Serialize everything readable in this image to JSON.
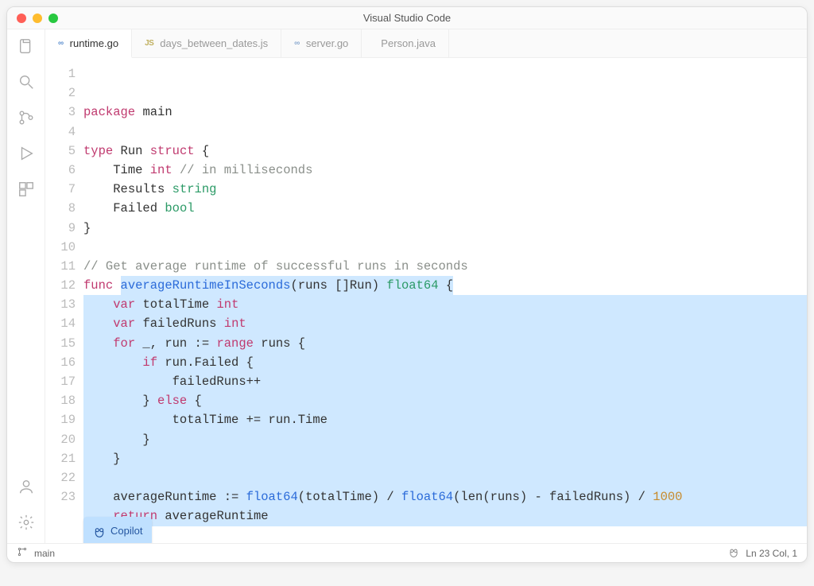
{
  "app_title": "Visual Studio Code",
  "tabs": [
    {
      "label": "runtime.go",
      "lang": "∞",
      "lang_class": "lang-go active-lang",
      "active": true
    },
    {
      "label": "days_between_dates.js",
      "lang": "JS",
      "lang_class": "lang-js",
      "active": false
    },
    {
      "label": "server.go",
      "lang": "∞",
      "lang_class": "lang-go",
      "active": false
    },
    {
      "label": "Person.java",
      "lang": "",
      "lang_class": "lang-java",
      "active": false
    }
  ],
  "code_lines": [
    {
      "n": 1,
      "hl": "none",
      "tokens": [
        [
          "kw",
          "package"
        ],
        [
          "plain",
          " "
        ],
        [
          "ident",
          "main"
        ]
      ]
    },
    {
      "n": 2,
      "hl": "none",
      "tokens": []
    },
    {
      "n": 3,
      "hl": "none",
      "tokens": [
        [
          "kw",
          "type"
        ],
        [
          "plain",
          " "
        ],
        [
          "ident",
          "Run"
        ],
        [
          "plain",
          " "
        ],
        [
          "kw",
          "struct"
        ],
        [
          "plain",
          " {"
        ]
      ]
    },
    {
      "n": 4,
      "hl": "none",
      "tokens": [
        [
          "plain",
          "    "
        ],
        [
          "ident",
          "Time"
        ],
        [
          "plain",
          " "
        ],
        [
          "kw",
          "int"
        ],
        [
          "plain",
          " "
        ],
        [
          "comment",
          "// in milliseconds"
        ]
      ]
    },
    {
      "n": 5,
      "hl": "none",
      "tokens": [
        [
          "plain",
          "    "
        ],
        [
          "ident",
          "Results"
        ],
        [
          "plain",
          " "
        ],
        [
          "typename",
          "string"
        ]
      ]
    },
    {
      "n": 6,
      "hl": "none",
      "tokens": [
        [
          "plain",
          "    "
        ],
        [
          "ident",
          "Failed"
        ],
        [
          "plain",
          " "
        ],
        [
          "typename",
          "bool"
        ]
      ]
    },
    {
      "n": 7,
      "hl": "none",
      "tokens": [
        [
          "plain",
          "}"
        ]
      ]
    },
    {
      "n": 8,
      "hl": "none",
      "tokens": []
    },
    {
      "n": 9,
      "hl": "none",
      "tokens": [
        [
          "comment",
          "// Get average runtime of successful runs in seconds"
        ]
      ]
    },
    {
      "n": 10,
      "hl": "partial-after-func",
      "tokens": [
        [
          "kw",
          "func"
        ],
        [
          "plain",
          " "
        ],
        [
          "name",
          "averageRuntimeInSeconds"
        ],
        [
          "plain",
          "(runs []Run) "
        ],
        [
          "typename",
          "float64"
        ],
        [
          "plain",
          " {"
        ]
      ]
    },
    {
      "n": 11,
      "hl": "full",
      "tokens": [
        [
          "plain",
          "    "
        ],
        [
          "kw",
          "var"
        ],
        [
          "plain",
          " "
        ],
        [
          "ident",
          "totalTime"
        ],
        [
          "plain",
          " "
        ],
        [
          "kw",
          "int"
        ]
      ]
    },
    {
      "n": 12,
      "hl": "full",
      "tokens": [
        [
          "plain",
          "    "
        ],
        [
          "kw",
          "var"
        ],
        [
          "plain",
          " "
        ],
        [
          "ident",
          "failedRuns"
        ],
        [
          "plain",
          " "
        ],
        [
          "kw",
          "int"
        ]
      ]
    },
    {
      "n": 13,
      "hl": "full",
      "tokens": [
        [
          "plain",
          "    "
        ],
        [
          "kw",
          "for"
        ],
        [
          "plain",
          " _, run := "
        ],
        [
          "kw",
          "range"
        ],
        [
          "plain",
          " runs {"
        ]
      ]
    },
    {
      "n": 14,
      "hl": "full",
      "tokens": [
        [
          "plain",
          "        "
        ],
        [
          "kw",
          "if"
        ],
        [
          "plain",
          " run.Failed {"
        ]
      ]
    },
    {
      "n": 15,
      "hl": "full",
      "tokens": [
        [
          "plain",
          "            failedRuns++"
        ]
      ]
    },
    {
      "n": 16,
      "hl": "full",
      "tokens": [
        [
          "plain",
          "        } "
        ],
        [
          "kw",
          "else"
        ],
        [
          "plain",
          " {"
        ]
      ]
    },
    {
      "n": 17,
      "hl": "full",
      "tokens": [
        [
          "plain",
          "            totalTime += run.Time"
        ]
      ]
    },
    {
      "n": 18,
      "hl": "full",
      "tokens": [
        [
          "plain",
          "        }"
        ]
      ]
    },
    {
      "n": 19,
      "hl": "full",
      "tokens": [
        [
          "plain",
          "    }"
        ]
      ]
    },
    {
      "n": 20,
      "hl": "full",
      "tokens": []
    },
    {
      "n": 21,
      "hl": "full",
      "tokens": [
        [
          "plain",
          "    averageRuntime := "
        ],
        [
          "name",
          "float64"
        ],
        [
          "plain",
          "(totalTime) / "
        ],
        [
          "name",
          "float64"
        ],
        [
          "plain",
          "(len(runs) - failedRuns) / "
        ],
        [
          "num",
          "1000"
        ]
      ]
    },
    {
      "n": 22,
      "hl": "full",
      "tokens": [
        [
          "plain",
          "    "
        ],
        [
          "kw",
          "return"
        ],
        [
          "plain",
          " averageRuntime"
        ]
      ]
    },
    {
      "n": 23,
      "hl": "short",
      "tokens": [
        [
          "plain",
          "}"
        ]
      ]
    }
  ],
  "copilot": {
    "label": "Copilot"
  },
  "statusbar": {
    "branch": "main",
    "position": "Ln 23 Col, 1"
  }
}
